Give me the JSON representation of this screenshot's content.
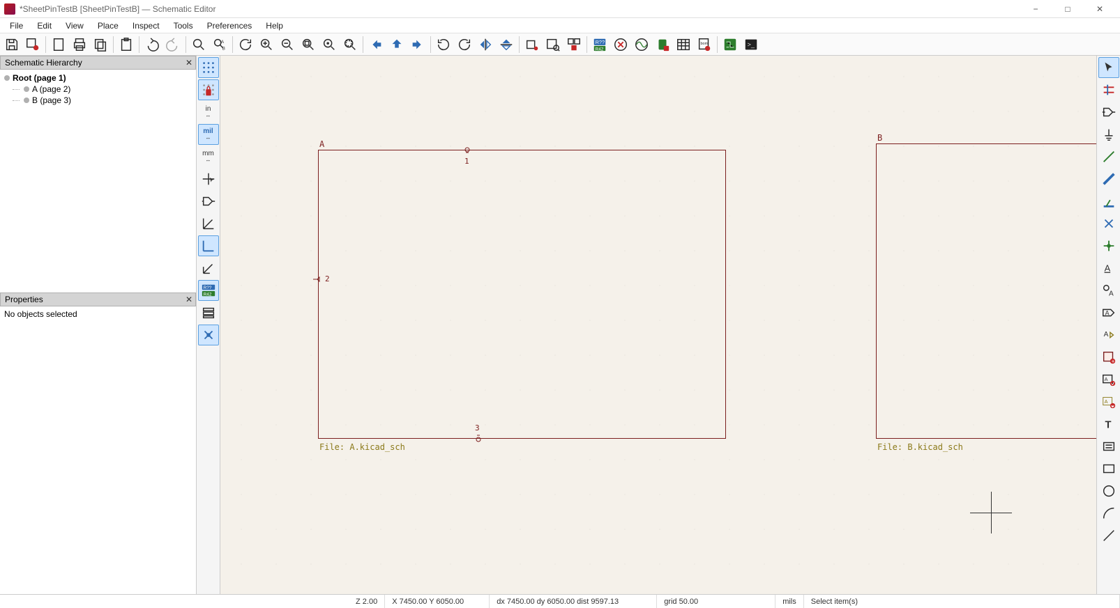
{
  "title": "*SheetPinTestB [SheetPinTestB] — Schematic Editor",
  "menu": [
    "File",
    "Edit",
    "View",
    "Place",
    "Inspect",
    "Tools",
    "Preferences",
    "Help"
  ],
  "panels": {
    "hierarchy": {
      "title": "Schematic Hierarchy",
      "root": "Root (page 1)",
      "children": [
        "A (page 2)",
        "B (page 3)"
      ]
    },
    "properties": {
      "title": "Properties",
      "body": "No objects selected"
    }
  },
  "left_strip": {
    "in": "in",
    "mil": "mil",
    "mm": "mm"
  },
  "canvas": {
    "sheet_a": {
      "label": "A",
      "file": "File: A.kicad_sch",
      "pin2": "2",
      "pin1": "1",
      "pin3": "3"
    },
    "sheet_b": {
      "label": "B",
      "file": "File: B.kicad_sch"
    }
  },
  "status": {
    "z": "Z 2.00",
    "xy": "X 7450.00  Y 6050.00",
    "dxy": "dx 7450.00  dy 6050.00  dist 9597.13",
    "grid": "grid 50.00",
    "units": "mils",
    "msg": "Select item(s)"
  }
}
